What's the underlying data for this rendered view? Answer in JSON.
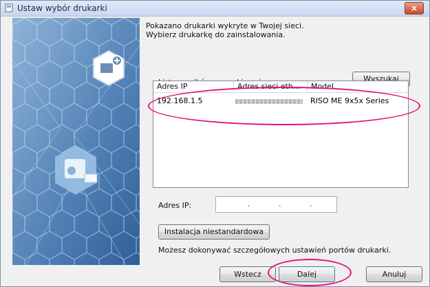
{
  "window": {
    "title": "Ustaw wybór drukarki",
    "close_label": "×"
  },
  "intro": {
    "line1": "Pokazano drukarki wykryte w Twojej sieci.",
    "line2": "Wybierz drukarkę do zainstalowania."
  },
  "results": {
    "label": "Lista wyników wyszukiwania:",
    "search_button": "Wyszukaj",
    "columns": [
      "Adres IP",
      "Adres sieci eth...",
      "Model"
    ],
    "rows": [
      {
        "ip": "192.168.1.5",
        "mac": "",
        "model": "RISO ME 9x5x Series"
      }
    ]
  },
  "ip_field": {
    "label": "Adres IP:",
    "value": ". . ."
  },
  "custom": {
    "button": "Instalacja niestandardowa",
    "hint": "Możesz dokonywać szczegółowych ustawień portów drukarki."
  },
  "footer": {
    "back": "Wstecz",
    "next": "Dalej",
    "cancel": "Anuluj"
  },
  "colors": {
    "highlight": "#e2137d",
    "side_panel": "#5f8fc1"
  }
}
